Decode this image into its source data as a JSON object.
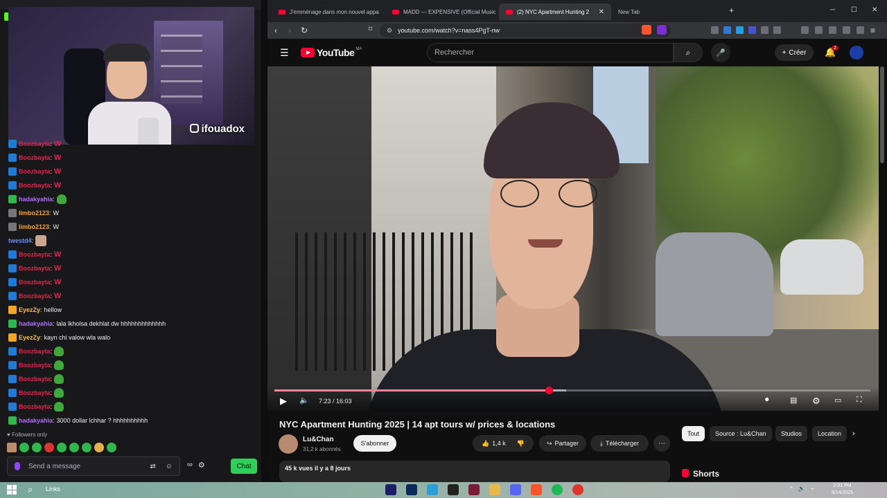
{
  "twitch": {
    "webcam_tag": "ifouadox",
    "chat": [
      {
        "badge": "mod",
        "user": "Boozbayta",
        "color": "#e8214c",
        "text": "W",
        "type": "w"
      },
      {
        "badge": "mod",
        "user": "Boozbayta",
        "color": "#e8214c",
        "text": "W",
        "type": "w"
      },
      {
        "badge": "mod",
        "user": "Boozbayta",
        "color": "#e8214c",
        "text": "W",
        "type": "w"
      },
      {
        "badge": "mod",
        "user": "Boozbayta",
        "color": "#e8214c",
        "text": "W",
        "type": "w"
      },
      {
        "badge": "pro",
        "user": "hadakyahia",
        "color": "#b36bff",
        "text": "",
        "type": "emote"
      },
      {
        "badge": "grey",
        "user": "limbo2123",
        "color": "#f5a623",
        "text": "W",
        "type": "text"
      },
      {
        "badge": "grey",
        "user": "limbo2123",
        "color": "#f5a623",
        "text": "W",
        "type": "text"
      },
      {
        "badge": "none",
        "user": "twestd4",
        "color": "#6e8cff",
        "text": "",
        "type": "face"
      },
      {
        "badge": "mod",
        "user": "Boozbayta",
        "color": "#e8214c",
        "text": "W",
        "type": "w"
      },
      {
        "badge": "mod",
        "user": "Boozbayta",
        "color": "#e8214c",
        "text": "W",
        "type": "w"
      },
      {
        "badge": "mod",
        "user": "Boozbayta",
        "color": "#e8214c",
        "text": "W",
        "type": "w"
      },
      {
        "badge": "mod",
        "user": "Boozbayta",
        "color": "#e8214c",
        "text": "W",
        "type": "w"
      },
      {
        "badge": "gold",
        "user": "EyezZy",
        "color": "#f5c242",
        "text": "hellow",
        "type": "text"
      },
      {
        "badge": "pro",
        "user": "hadakyahia",
        "color": "#b36bff",
        "text": "lala lkholsa dekhlat dw hhhhhhhhhhhhh",
        "type": "text"
      },
      {
        "badge": "gold",
        "user": "EyezZy",
        "color": "#f5c242",
        "text": "kayn chi valow wla walo",
        "type": "text"
      },
      {
        "badge": "mod",
        "user": "Boozbayta",
        "color": "#e8214c",
        "text": "",
        "type": "emote"
      },
      {
        "badge": "mod",
        "user": "Boozbayta",
        "color": "#e8214c",
        "text": "",
        "type": "emote"
      },
      {
        "badge": "mod",
        "user": "Boozbayta",
        "color": "#e8214c",
        "text": "",
        "type": "emote"
      },
      {
        "badge": "mod",
        "user": "Boozbayta",
        "color": "#e8214c",
        "text": "",
        "type": "emote"
      },
      {
        "badge": "mod",
        "user": "Boozbayta",
        "color": "#e8214c",
        "text": "",
        "type": "emote"
      },
      {
        "badge": "pro",
        "user": "hadakyahia",
        "color": "#b36bff",
        "text": "3000 dollar lchhar ? hhhhhhhhhh",
        "type": "text"
      }
    ],
    "followers_only": "Followers only",
    "input_placeholder": "Send a message",
    "chat_button": "Chat"
  },
  "browser": {
    "tabs": [
      {
        "label": "J'emménage dans mon nouvel appa",
        "active": false
      },
      {
        "label": "MADD — EXPENSIVE (Official Music",
        "active": false
      },
      {
        "label": "(2) NYC Apartment Hunting 2",
        "active": true
      },
      {
        "label": "New Tab",
        "active": false
      }
    ],
    "url": "youtube.com/watch?v=nass4PgT-nw"
  },
  "youtube": {
    "logo": "YouTube",
    "country": "MA",
    "search_placeholder": "Rechercher",
    "create_label": "Créer",
    "notifications": "2",
    "player": {
      "time": "7:23 / 16:03",
      "progress": 0.46,
      "buffered": 0.49
    },
    "title": "NYC Apartment Hunting 2025 | 14 apt tours w/ prices & locations",
    "channel": "Lu&Chan",
    "subscribers": "31,2 k abonnés",
    "subscribe_label": "S'abonner",
    "likes": "1,4 k",
    "share_label": "Partager",
    "download_label": "Télécharger",
    "chips": [
      "Tout",
      "Source : Lu&Chan",
      "Studios",
      "Location"
    ],
    "description": "45 k vues  il y a 8 jours",
    "shorts_label": "Shorts"
  },
  "taskbar": {
    "search_label": "Links",
    "clock_time": "2:01 PM",
    "clock_date": "8/14/2025"
  }
}
